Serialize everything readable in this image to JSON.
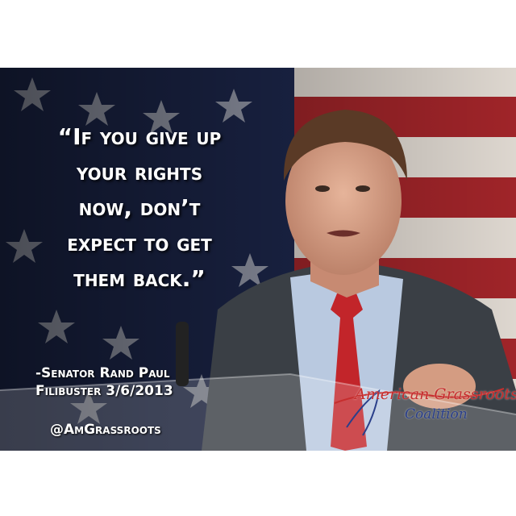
{
  "quote": {
    "lines": [
      "“If you give up",
      "your rights",
      "now, don’t",
      "expect to get",
      "them back.”"
    ]
  },
  "attribution": {
    "line1": "-Senator Rand Paul",
    "line2": "Filibuster 3/6/2013"
  },
  "handle": "@AmGrassroots",
  "logo": {
    "line1": "American Grassroots",
    "line2": "Coalition"
  },
  "colors": {
    "flag_blue": "#1f2a52",
    "flag_red": "#a8262b",
    "tie_red": "#c2252a",
    "logo_red": "#c62d2d",
    "logo_blue": "#2a3f8a"
  }
}
